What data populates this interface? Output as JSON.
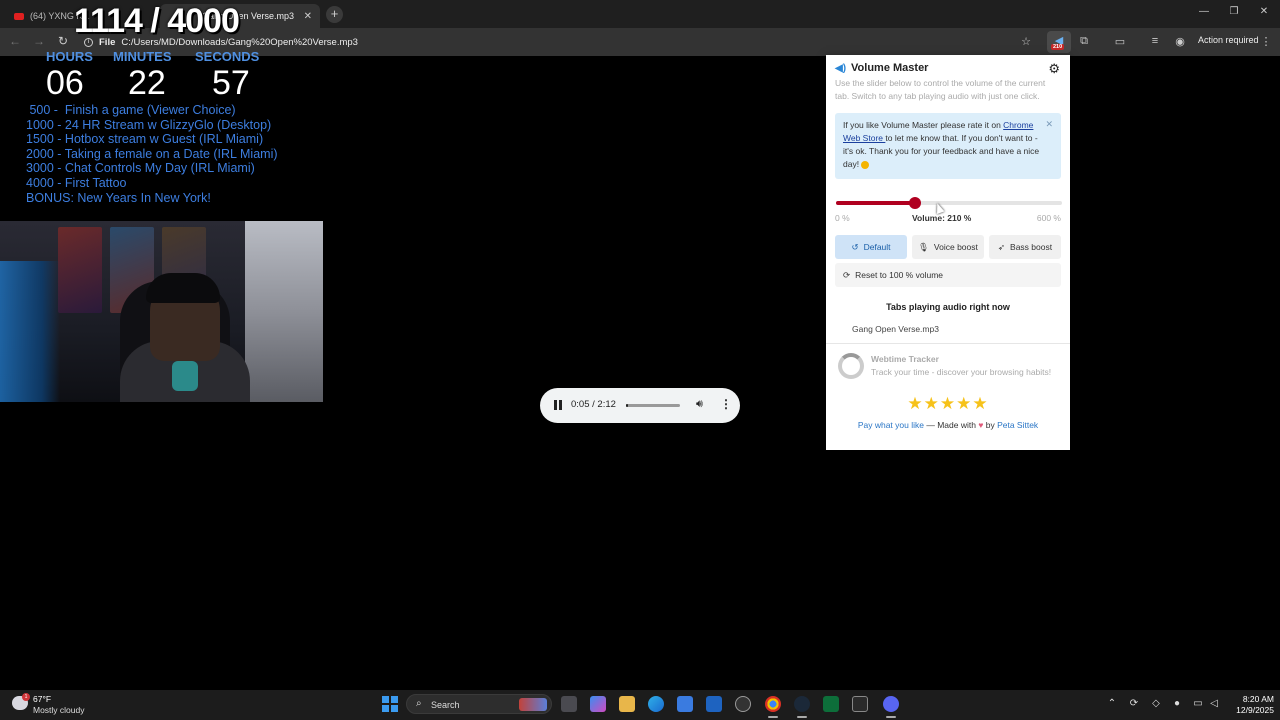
{
  "browser": {
    "tabs": [
      {
        "title": "(64) YXNG K...",
        "icon": "youtube-icon"
      },
      {
        "title": "Gang Open Verse.mp3",
        "icon": "media-icon"
      }
    ],
    "tab_close": "✕",
    "new_tab": "+",
    "window_controls": {
      "minimize": "—",
      "restore": "❐",
      "close": "✕"
    },
    "address_chip": "File",
    "address_url": "C:/Users/MD/Downloads/Gang%20Open%20Verse.mp3",
    "extension_badge": "210",
    "action_required": "Action required"
  },
  "overlay": {
    "goal_counter": "1114 / 4000",
    "timer_labels": {
      "hours": "HOURS",
      "minutes": "MINUTES",
      "seconds": "SECONDS"
    },
    "timer_values": {
      "hours": "06",
      "minutes": "22",
      "seconds": "57"
    },
    "goals": [
      " 500 -  Finish a game (Viewer Choice)",
      "1000 - 24 HR Stream w GlizzyGlo (Desktop)",
      "1500 - Hotbox stream w Guest (IRL Miami)",
      "2000 - Taking a female on a Date (IRL Miami)",
      "3000 - Chat Controls My Day (IRL Miami)",
      "4000 - First Tattoo",
      "BONUS: New Years In New York!"
    ]
  },
  "player": {
    "time": "0:05 / 2:12",
    "progress": 0.04,
    "state": "playing"
  },
  "volume_master": {
    "title": "Volume Master",
    "description": "Use the slider below to control the volume of the current tab. Switch to any tab playing audio with just one click.",
    "notice_before": "If you like Volume Master please rate it on ",
    "notice_link": "Chrome Web Store ",
    "notice_after": "to let me know that. If you don't want to - it's ok. Thank you for your feedback and have a nice day! ",
    "notice_close": "✕",
    "slider_min": "0 %",
    "slider_max": "600 %",
    "volume_label": "Volume: 210 %",
    "volume_percent": 210,
    "volume_max_percent": 600,
    "modes": {
      "default": "Default",
      "voice": "Voice boost",
      "bass": "Bass boost"
    },
    "active_mode": "default",
    "reset_label": "Reset to 100 % volume",
    "tabs_heading": "Tabs playing audio right now",
    "tabs_playing": [
      "Gang Open Verse.mp3"
    ],
    "promo_title": "Webtime Tracker",
    "promo_desc": "Track your time - discover your browsing habits!",
    "stars": "★★★★★",
    "footer_pay": "Pay what you like",
    "footer_mid": " — Made with ",
    "footer_heart": "♥",
    "footer_by": " by ",
    "footer_author": "Peta Sittek"
  },
  "taskbar": {
    "weather_temp": "67°F",
    "weather_condition": "Mostly cloudy",
    "weather_badge": "1",
    "search_label": "Search",
    "time": "8:20 AM",
    "date": "12/9/2025"
  },
  "colors": {
    "accent_red": "#b00020",
    "overlay_blue": "#3d7ee0",
    "notice_bg": "#dceefa",
    "star_yellow": "#f6c21a"
  }
}
